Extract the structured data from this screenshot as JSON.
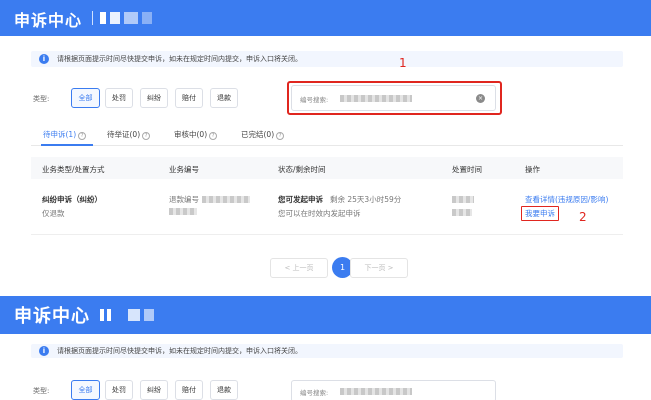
{
  "header": {
    "title": "申诉中心"
  },
  "notice": {
    "text": "请根据页面提示时间尽快提交申诉，如未在规定时间内提交，申诉入口将关闭。"
  },
  "filters": {
    "type_label": "类型:",
    "types": [
      "全部",
      "处罚",
      "纠纷",
      "赔付",
      "退款"
    ],
    "active_type": "全部",
    "search_label": "编号搜索:"
  },
  "annotations": {
    "marker1": "1",
    "marker2": "2"
  },
  "tabs": [
    {
      "label": "待申诉(1)",
      "active": true
    },
    {
      "label": "待举证(0)",
      "active": false
    },
    {
      "label": "审核中(0)",
      "active": false
    },
    {
      "label": "已完结(0)",
      "active": false
    }
  ],
  "table": {
    "columns": [
      "业务类型/处置方式",
      "业务编号",
      "状态/剩余时间",
      "处置时间",
      "操作"
    ],
    "rows": [
      {
        "type": "纠纷申诉（纠纷）",
        "method": "仅退款",
        "number_prefix": "退款编号",
        "status": "您可发起申诉",
        "remaining": "剩余 25天3小时59分",
        "status_note": "您可以在时效内发起申诉",
        "actions": [
          "查看详情(违规原因/影响)",
          "我要申诉"
        ]
      }
    ]
  },
  "pagination": {
    "prev": "< 上一页",
    "page": "1",
    "next": "下一页 >"
  },
  "colors": {
    "brand": "#3b7cf0",
    "annotation_red": "#e0261f"
  }
}
